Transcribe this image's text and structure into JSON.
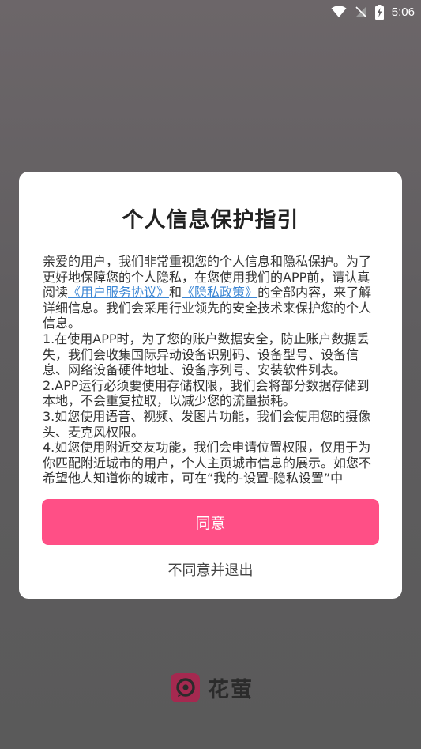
{
  "status_bar": {
    "time": "5:06",
    "icons": [
      "wifi-icon",
      "signal-off-icon",
      "battery-charging-icon"
    ]
  },
  "dialog": {
    "title": "个人信息保护指引",
    "paragraph_intro_part1": "亲爱的用户，我们非常重视您的个人信息和隐私保护。为了更好地保障您的个人隐私，在您使用我们的APP前，请认真阅读",
    "link_user_agreement": "《用户服务协议》",
    "connector_and": "和",
    "link_privacy_policy": "《隐私政策》",
    "paragraph_intro_part2": "的全部内容，来了解详细信息。我们会采用行业领先的安全技术来保护您的个人信息。",
    "item_1": "1.在使用APP时，为了您的账户数据安全，防止账户数据丢失，我们会收集国际异动设备识别码、设备型号、设备信息、网络设备硬件地址、设备序列号、安装软件列表。",
    "item_2": "2.APP运行必须要使用存储权限，我们会将部分数据存储到本地，不会重复拉取，以减少您的流量损耗。",
    "item_3": "3.如您使用语音、视频、发图片功能，我们会使用您的摄像头、麦克风权限。",
    "item_4": "4.如您使用附近交友功能，我们会申请位置权限，仅用于为你匹配附近城市的用户，个人主页城市信息的展示。如您不希望他人知道你的城市，可在“我的-设置-隐私设置”中",
    "agree_label": "同意",
    "disagree_label": "不同意并退出"
  },
  "brand": {
    "name": "花萤",
    "logo_icon": "huaying-logo-icon"
  },
  "colors": {
    "accent": "#ff4f86",
    "link": "#3b86d4",
    "brand_logo": "#a52950"
  }
}
